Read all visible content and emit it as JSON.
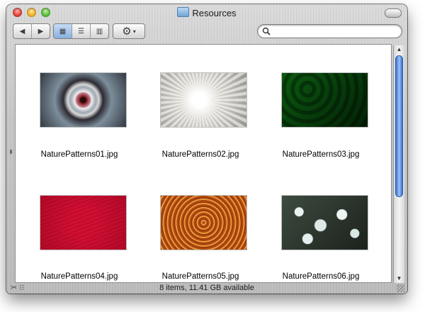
{
  "window": {
    "title": "Resources",
    "buttons": {
      "close": "close",
      "minimize": "minimize",
      "zoom": "zoom"
    }
  },
  "toolbar": {
    "back_icon": "◀",
    "forward_icon": "▶",
    "icon_view_icon": "▦",
    "list_view_icon": "☰",
    "column_view_icon": "▥",
    "action_icon": "⚙",
    "action_caret": "▾",
    "search": {
      "value": "",
      "placeholder": ""
    }
  },
  "files": [
    {
      "name": "NaturePatterns01.jpg"
    },
    {
      "name": "NaturePatterns02.jpg"
    },
    {
      "name": "NaturePatterns03.jpg"
    },
    {
      "name": "NaturePatterns04.jpg"
    },
    {
      "name": "NaturePatterns05.jpg"
    },
    {
      "name": "NaturePatterns06.jpg"
    }
  ],
  "status": {
    "text": "8 items, 11.41 GB available"
  },
  "scrollbar": {
    "up_icon": "▲",
    "down_icon": "▼",
    "position_fraction": 0.0,
    "visible_fraction": 0.65
  },
  "colors": {
    "accent": "#3a6fc7",
    "selected_segment": "#87afe2"
  }
}
